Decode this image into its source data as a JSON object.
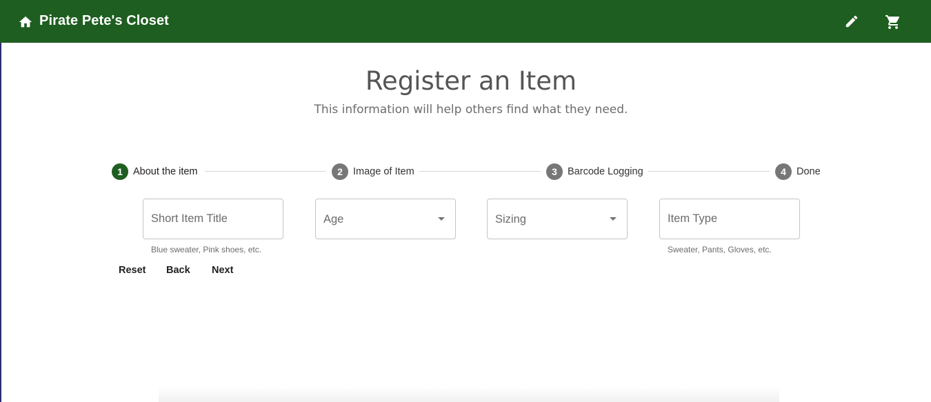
{
  "app_bar": {
    "home_icon": "home-icon",
    "title": "Pirate Pete's Closet",
    "edit_icon": "pencil-icon",
    "cart_icon": "shopping-cart-icon",
    "color": "#1e5e20"
  },
  "page": {
    "title": "Register an Item",
    "subtitle": "This information will help others find what they need."
  },
  "stepper": {
    "steps": [
      {
        "number": "1",
        "label": "About the item",
        "active": true
      },
      {
        "number": "2",
        "label": "Image of Item",
        "active": false
      },
      {
        "number": "3",
        "label": "Barcode Logging",
        "active": false
      },
      {
        "number": "4",
        "label": "Done",
        "active": false
      }
    ]
  },
  "form": {
    "title_field": {
      "placeholder": "Short Item Title",
      "value": "",
      "helper": "Blue sweater, Pink shoes, etc."
    },
    "age_select": {
      "label": "Age",
      "value": ""
    },
    "sizing_select": {
      "label": "Sizing",
      "value": ""
    },
    "type_field": {
      "placeholder": "Item Type",
      "value": "",
      "helper": "Sweater, Pants, Gloves, etc."
    }
  },
  "actions": {
    "reset_label": "Reset",
    "back_label": "Back",
    "next_label": "Next"
  }
}
